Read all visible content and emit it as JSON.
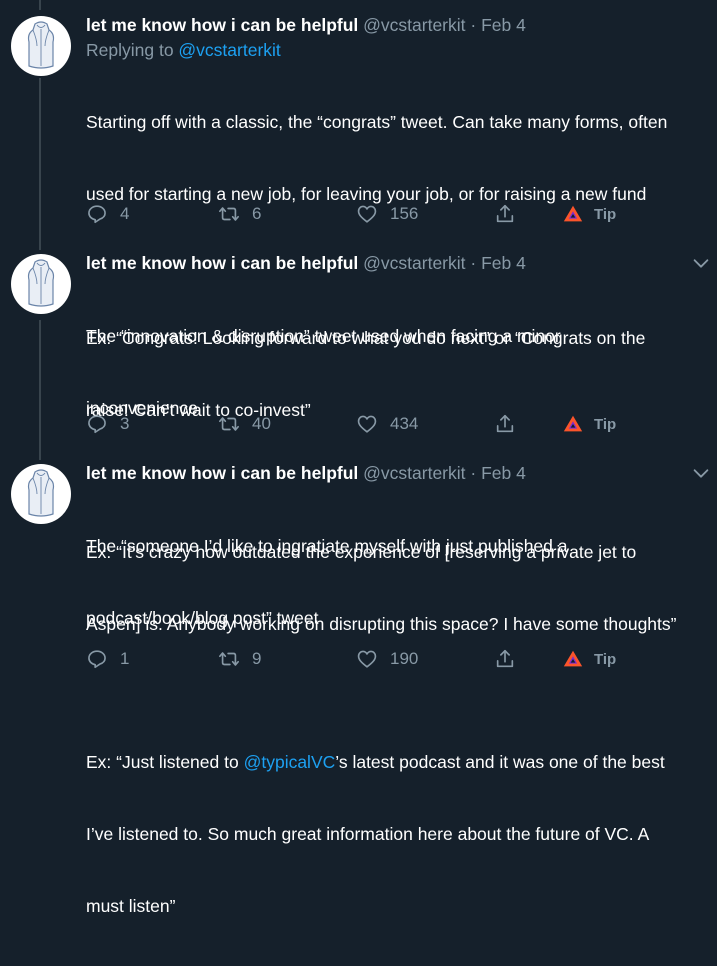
{
  "tweets": [
    {
      "author": "let me know how i can be helpful",
      "handle": "@vcstarterkit",
      "separator": "·",
      "date": "Feb 4",
      "replying_prefix": "Replying to ",
      "replying_to": "@vcstarterkit",
      "line1": "Starting off with a classic, the “congrats” tweet. Can take many forms, often",
      "line2": "used for starting a new job, for leaving your job, or for raising a new fund",
      "line3": "Ex: “Congrats! Looking forward to what you do next” or “Congrats on the",
      "line4": "raise! Can’t wait to co-invest”",
      "replies": "4",
      "retweets": "6",
      "likes": "156",
      "tip": "Tip"
    },
    {
      "author": "let me know how i can be helpful",
      "handle": "@vcstarterkit",
      "separator": "·",
      "date": "Feb 4",
      "line1": "The “innovation & disruption” tweet used when facing a minor",
      "line2": "inconvenience",
      "line3": "Ex: “It’s crazy how outdated the experience of [reserving a private jet to",
      "line4": "Aspen] is. Anybody working on disrupting this space? I have some thoughts”",
      "replies": "3",
      "retweets": "40",
      "likes": "434",
      "tip": "Tip"
    },
    {
      "author": "let me know how i can be helpful",
      "handle": "@vcstarterkit",
      "separator": "·",
      "date": "Feb 4",
      "line1": "The “someone I’d like to ingratiate myself with just published a",
      "line2": "podcast/book/blog post” tweet",
      "line3_pre": "Ex: “Just listened to ",
      "line3_mention": "@typicalVC",
      "line3_post": "’s latest podcast and it was one of the best",
      "line4": "I’ve listened to. So much great information here about the future of VC. A",
      "line5": "must listen”",
      "replies": "1",
      "retweets": "9",
      "likes": "190",
      "tip": "Tip"
    }
  ],
  "colors": {
    "background": "#15202b",
    "text": "#ffffff",
    "secondary": "#8899a6",
    "link": "#1da1f2",
    "thread_line": "#38444d",
    "brave_orange": "#fb542b"
  }
}
